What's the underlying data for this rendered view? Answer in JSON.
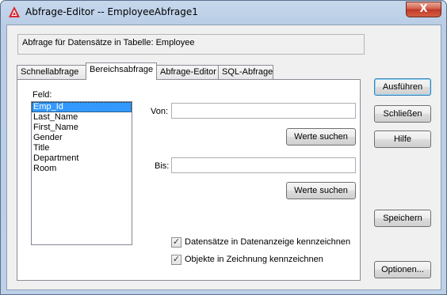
{
  "window": {
    "title": "Abfrage-Editor -- EmployeeAbfrage1",
    "close_label": "X"
  },
  "info": {
    "text": "Abfrage für Datensätze in Tabelle:  Employee"
  },
  "tabs": [
    {
      "label": "Schnellabfrage",
      "active": false
    },
    {
      "label": "Bereichsabfrage",
      "active": true
    },
    {
      "label": "Abfrage-Editor",
      "active": false
    },
    {
      "label": "SQL-Abfrage",
      "active": false
    }
  ],
  "panel": {
    "field_label": "Feld:",
    "fields": [
      "Emp_Id",
      "Last_Name",
      "First_Name",
      "Gender",
      "Title",
      "Department",
      "Room"
    ],
    "selected_field": "Emp_Id",
    "von_label": "Von:",
    "von_value": "",
    "bis_label": "Bis:",
    "bis_value": "",
    "search_values_1": "Werte suchen",
    "search_values_2": "Werte suchen",
    "check_datasets_label": "Datensätze in Datenanzeige kennzeichnen",
    "check_datasets_checked": true,
    "check_objects_label": "Objekte in Zeichnung kennzeichnen",
    "check_objects_checked": true
  },
  "buttons": {
    "execute": "Ausführen",
    "close": "Schließen",
    "help": "Hilfe",
    "save": "Speichern",
    "options": "Optionen..."
  },
  "colors": {
    "selection": "#3399ff",
    "titlebar": "#b9cde6",
    "close_button": "#c0382a"
  }
}
